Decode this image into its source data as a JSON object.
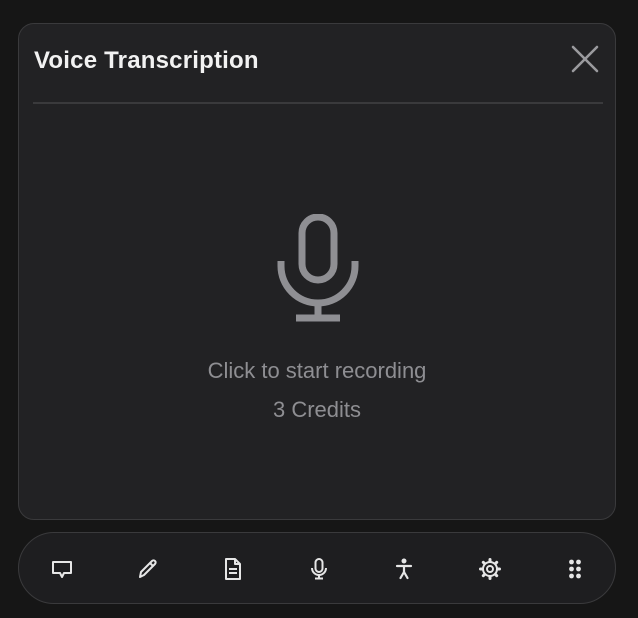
{
  "dialog": {
    "title": "Voice Transcription",
    "close_icon": "close-icon",
    "mic_icon": "microphone-icon",
    "prompt": "Click to start recording",
    "credits": "3 Credits"
  },
  "toolbar": {
    "items": [
      {
        "icon": "chat-bubble-icon"
      },
      {
        "icon": "pencil-icon"
      },
      {
        "icon": "document-icon"
      },
      {
        "icon": "microphone-icon"
      },
      {
        "icon": "accessibility-icon"
      },
      {
        "icon": "gear-icon"
      },
      {
        "icon": "grid-dots-icon"
      }
    ]
  },
  "colors": {
    "background": "#161616",
    "panel": "#222224",
    "border": "#3a3a3c",
    "title": "#f2f2f2",
    "muted": "#8e8e92",
    "icon": "#e6e6e6"
  }
}
